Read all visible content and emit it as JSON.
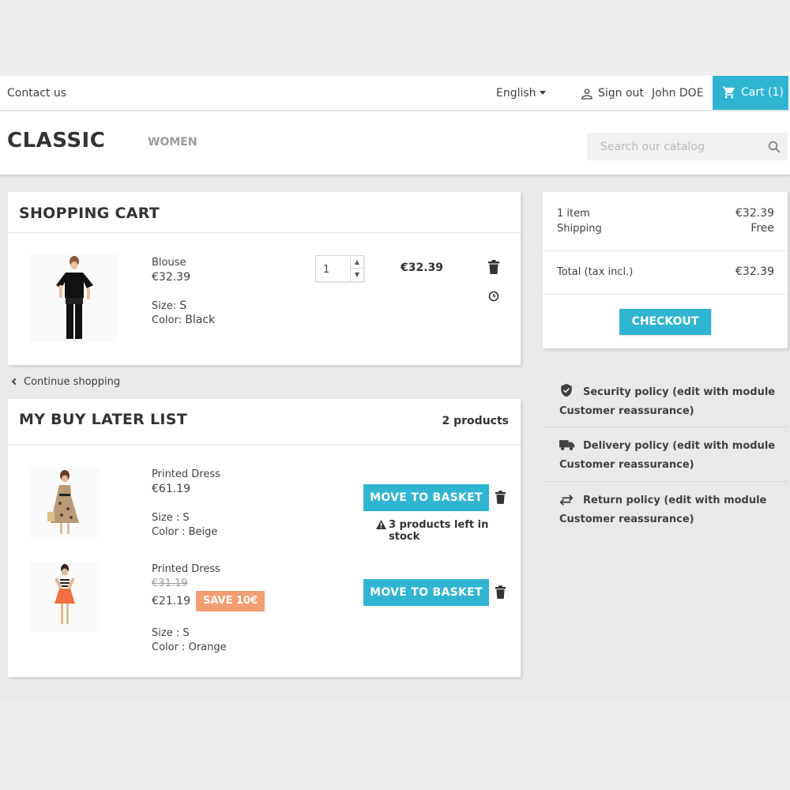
{
  "topnav": {
    "contact": "Contact us",
    "language": "English",
    "sign_out": "Sign out",
    "user_name": "John DOE",
    "cart": "Cart (1)"
  },
  "header": {
    "logo": "CLASSIC",
    "menu": [
      "WOMEN"
    ],
    "search_placeholder": "Search our catalog"
  },
  "cart": {
    "title": "SHOPPING CART",
    "items": [
      {
        "name": "Blouse",
        "price": "€32.39",
        "size_label": "Size:",
        "size": "S",
        "color_label": "Color:",
        "color": "Black",
        "quantity": "1",
        "line_total": "€32.39"
      }
    ]
  },
  "continue_shopping": "Continue shopping",
  "buy_later": {
    "title": "MY BUY LATER LIST",
    "count": "2 products",
    "move_label": "MOVE TO BASKET",
    "items": [
      {
        "name": "Printed Dress",
        "price": "€61.19",
        "size": "Size : S",
        "color": "Color : Beige",
        "stock_note": "3 products left in stock"
      },
      {
        "name": "Printed Dress",
        "old_price": "€31.19",
        "price": "€21.19",
        "badge": "SAVE 10€",
        "size": "Size : S",
        "color": "Color : Orange"
      }
    ]
  },
  "summary": {
    "items_label": "1 item",
    "items_value": "€32.39",
    "shipping_label": "Shipping",
    "shipping_value": "Free",
    "total_label": "Total (tax incl.)",
    "total_value": "€32.39",
    "checkout": "CHECKOUT"
  },
  "reassurance": [
    {
      "icon": "shield-icon",
      "line1": "Security policy (edit with module",
      "line2": "Customer reassurance)"
    },
    {
      "icon": "truck-icon",
      "line1": "Delivery policy (edit with module",
      "line2": "Customer reassurance)"
    },
    {
      "icon": "swap-arrows-icon",
      "line1": "Return policy (edit with module",
      "line2": "Customer reassurance)"
    }
  ],
  "colors": {
    "accent": "#2fb5d2",
    "badge": "#f39d72",
    "text": "#414141"
  }
}
